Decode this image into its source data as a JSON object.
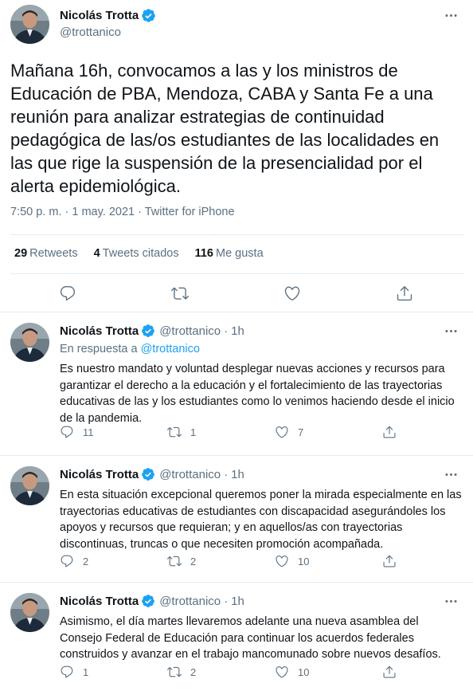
{
  "main_tweet": {
    "author_name": "Nicolás Trotta",
    "handle": "@trottanico",
    "text": "Mañana 16h, convocamos a las y los ministros de Educación de PBA, Mendoza, CABA y Santa Fe a una reunión para analizar estrategias de continuidad pedagógica de las/os estudiantes de las localidades en las que rige la suspensión de la presencialidad por el alerta epidemiológica.",
    "meta": "7:50 p. m. · 1 may. 2021 · Twitter for iPhone",
    "stats": [
      {
        "count": "29",
        "label": "Retweets"
      },
      {
        "count": "4",
        "label": "Tweets citados"
      },
      {
        "count": "116",
        "label": "Me gusta"
      }
    ]
  },
  "replies": [
    {
      "author_name": "Nicolás Trotta",
      "handle": "@trottanico",
      "time": "1h",
      "in_reply_label": "En respuesta a",
      "in_reply_handle": "@trottanico",
      "text": "Es nuestro mandato y voluntad desplegar nuevas acciones y recursos para garantizar el derecho a la educación y el fortalecimiento de las trayectorias educativas de las y los estudiantes como lo venimos haciendo desde el inicio de la pandemia.",
      "replies": "11",
      "retweets": "1",
      "likes": "7"
    },
    {
      "author_name": "Nicolás Trotta",
      "handle": "@trottanico",
      "time": "1h",
      "text": "En esta situación excepcional queremos poner la mirada especialmente en las trayectorias educativas de estudiantes con discapacidad asegurándoles los apoyos y recursos que requieran; y en aquellos/as con trayectorias discontinuas, truncas o que necesiten promoción acompañada.",
      "replies": "2",
      "retweets": "2",
      "likes": "10"
    },
    {
      "author_name": "Nicolás Trotta",
      "handle": "@trottanico",
      "time": "1h",
      "text": "Asimismo, el día martes llevaremos adelante una nueva asamblea del Consejo Federal de Educación para continuar los acuerdos federales construidos y avanzar en el trabajo mancomunado sobre nuevos desafíos.",
      "replies": "1",
      "retweets": "2",
      "likes": "10"
    }
  ],
  "colors": {
    "verified": "#1da1f2",
    "secondary_text": "#5b7083",
    "divider": "#e6ecf0"
  }
}
